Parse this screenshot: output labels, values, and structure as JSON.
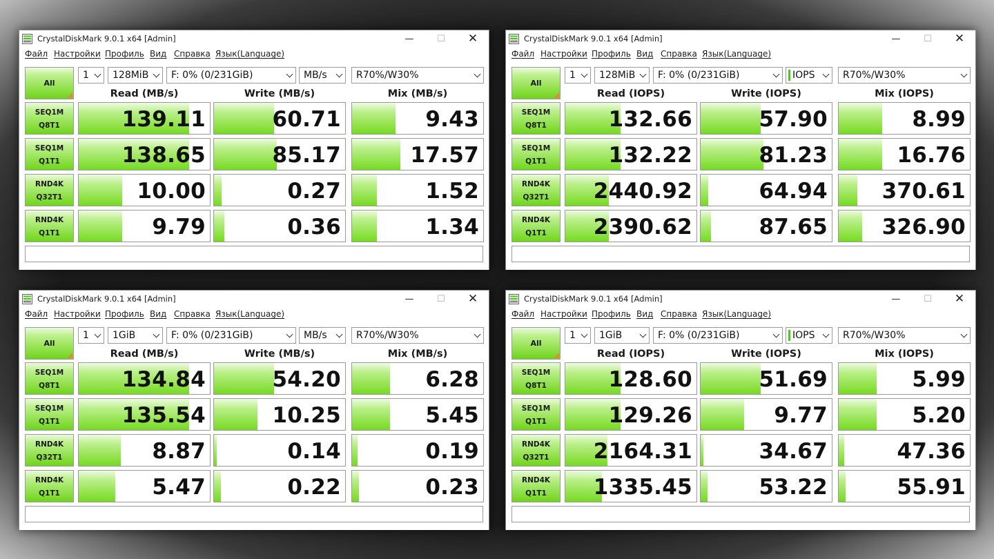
{
  "windows": [
    {
      "title": "CrystalDiskMark 9.0.1 x64 [Admin]",
      "menu": [
        "Файл",
        "Настройки",
        "Профиль",
        "Вид",
        "Справка",
        "Язык(Language)"
      ],
      "all_label": "All",
      "count": "1",
      "size": "128MiB",
      "drive": "F: 0% (0/231GiB)",
      "unit": "MB/s",
      "mix": "R70%/W30%",
      "headers": [
        "Read (MB/s)",
        "Write (MB/s)",
        "Mix (MB/s)"
      ],
      "rows": [
        {
          "l1": "SEQ1M",
          "l2": "Q8T1",
          "values": [
            "139.11",
            "60.71",
            "9.43"
          ],
          "fill": [
            0.84,
            0.46,
            0.33
          ]
        },
        {
          "l1": "SEQ1M",
          "l2": "Q1T1",
          "values": [
            "138.65",
            "85.17",
            "17.57"
          ],
          "fill": [
            0.84,
            0.48,
            0.37
          ]
        },
        {
          "l1": "RND4K",
          "l2": "Q32T1",
          "values": [
            "10.00",
            "0.27",
            "1.52"
          ],
          "fill": [
            0.33,
            0.06,
            0.19
          ]
        },
        {
          "l1": "RND4K",
          "l2": "Q1T1",
          "values": [
            "9.79",
            "0.36",
            "1.34"
          ],
          "fill": [
            0.33,
            0.08,
            0.19
          ]
        }
      ]
    },
    {
      "title": "CrystalDiskMark 9.0.1 x64 [Admin]",
      "menu": [
        "Файл",
        "Настройки",
        "Профиль",
        "Вид",
        "Справка",
        "Язык(Language)"
      ],
      "all_label": "All",
      "count": "1",
      "size": "128MiB",
      "drive": "F: 0% (0/231GiB)",
      "unit": "IOPS",
      "mix": "R70%/W30%",
      "headers": [
        "Read (IOPS)",
        "Write (IOPS)",
        "Mix (IOPS)"
      ],
      "rows": [
        {
          "l1": "SEQ1M",
          "l2": "Q8T1",
          "values": [
            "132.66",
            "57.90",
            "8.99"
          ],
          "fill": [
            0.42,
            0.46,
            0.33
          ]
        },
        {
          "l1": "SEQ1M",
          "l2": "Q1T1",
          "values": [
            "132.22",
            "81.23",
            "16.76"
          ],
          "fill": [
            0.42,
            0.48,
            0.33
          ]
        },
        {
          "l1": "RND4K",
          "l2": "Q32T1",
          "values": [
            "2440.92",
            "64.94",
            "370.61"
          ],
          "fill": [
            0.33,
            0.06,
            0.14
          ]
        },
        {
          "l1": "RND4K",
          "l2": "Q1T1",
          "values": [
            "2390.62",
            "87.65",
            "326.90"
          ],
          "fill": [
            0.33,
            0.08,
            0.18
          ]
        }
      ]
    },
    {
      "title": "CrystalDiskMark 9.0.1 x64 [Admin]",
      "menu": [
        "Файл",
        "Настройки",
        "Профиль",
        "Вид",
        "Справка",
        "Язык(Language)"
      ],
      "all_label": "All",
      "count": "1",
      "size": "1GiB",
      "drive": "F: 0% (0/231GiB)",
      "unit": "MB/s",
      "mix": "R70%/W30%",
      "headers": [
        "Read (MB/s)",
        "Write (MB/s)",
        "Mix (MB/s)"
      ],
      "rows": [
        {
          "l1": "SEQ1M",
          "l2": "Q8T1",
          "values": [
            "134.84",
            "54.20",
            "6.28"
          ],
          "fill": [
            0.84,
            0.46,
            0.29
          ]
        },
        {
          "l1": "SEQ1M",
          "l2": "Q1T1",
          "values": [
            "135.54",
            "10.25",
            "5.45"
          ],
          "fill": [
            0.84,
            0.33,
            0.29
          ]
        },
        {
          "l1": "RND4K",
          "l2": "Q32T1",
          "values": [
            "8.87",
            "0.14",
            "0.19"
          ],
          "fill": [
            0.32,
            0.02,
            0.04
          ]
        },
        {
          "l1": "RND4K",
          "l2": "Q1T1",
          "values": [
            "5.47",
            "0.22",
            "0.23"
          ],
          "fill": [
            0.28,
            0.05,
            0.05
          ]
        }
      ]
    },
    {
      "title": "CrystalDiskMark 9.0.1 x64 [Admin]",
      "menu": [
        "Файл",
        "Настройки",
        "Профиль",
        "Вид",
        "Справка",
        "Язык(Language)"
      ],
      "all_label": "All",
      "count": "1",
      "size": "1GiB",
      "drive": "F: 0% (0/231GiB)",
      "unit": "IOPS",
      "mix": "R70%/W30%",
      "headers": [
        "Read (IOPS)",
        "Write (IOPS)",
        "Mix (IOPS)"
      ],
      "rows": [
        {
          "l1": "SEQ1M",
          "l2": "Q8T1",
          "values": [
            "128.60",
            "51.69",
            "5.99"
          ],
          "fill": [
            0.42,
            0.46,
            0.29
          ]
        },
        {
          "l1": "SEQ1M",
          "l2": "Q1T1",
          "values": [
            "129.26",
            "9.77",
            "5.20"
          ],
          "fill": [
            0.42,
            0.33,
            0.29
          ]
        },
        {
          "l1": "RND4K",
          "l2": "Q32T1",
          "values": [
            "2164.31",
            "34.67",
            "47.36"
          ],
          "fill": [
            0.32,
            0.02,
            0.04
          ]
        },
        {
          "l1": "RND4K",
          "l2": "Q1T1",
          "values": [
            "1335.45",
            "53.22",
            "55.91"
          ],
          "fill": [
            0.28,
            0.05,
            0.05
          ]
        }
      ]
    }
  ],
  "colors": {
    "bar_green": "#76da22",
    "sort_corner": "#e28a3c",
    "unit_mark": "#4cc81a"
  }
}
